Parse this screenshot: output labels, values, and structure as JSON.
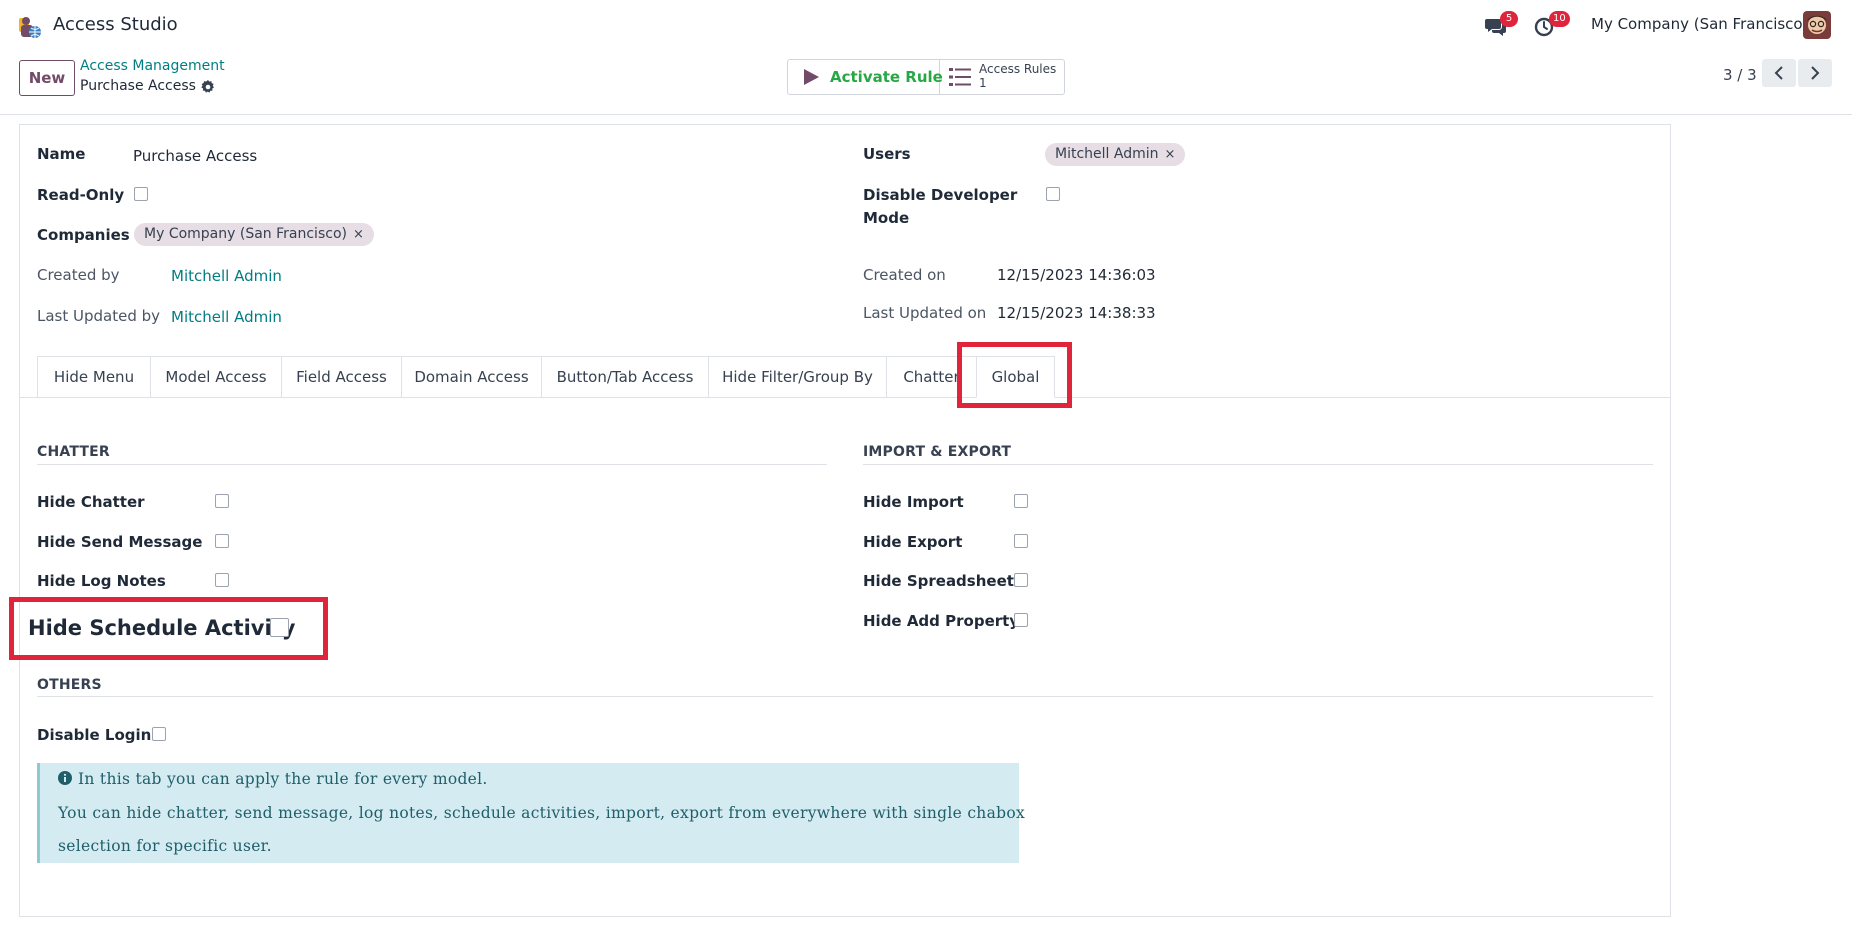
{
  "navbar": {
    "app_title": "Access Studio",
    "messages_badge": "5",
    "activities_badge": "10",
    "company": "My Company (San Francisco)"
  },
  "control_panel": {
    "new_label": "New",
    "breadcrumb_parent": "Access Management",
    "breadcrumb_current": "Purchase Access",
    "activate_label": "Activate Rule",
    "access_rules_label": "Access Rules",
    "access_rules_count": "1",
    "pager": "3 / 3"
  },
  "form": {
    "name_label": "Name",
    "name_value": "Purchase Access",
    "readonly_label": "Read-Only",
    "companies_label": "Companies",
    "companies_tag": "My Company (San Francisco)",
    "created_by_label": "Created by",
    "created_by_value": "Mitchell Admin",
    "last_updated_by_label": "Last Updated by",
    "last_updated_by_value": "Mitchell Admin",
    "users_label": "Users",
    "users_tag": "Mitchell Admin",
    "disable_dev_label_1": "Disable Developer",
    "disable_dev_label_2": "Mode",
    "created_on_label": "Created on",
    "created_on_value": "12/15/2023 14:36:03",
    "last_updated_on_label": "Last Updated on",
    "last_updated_on_value": "12/15/2023 14:38:33"
  },
  "tabs": [
    {
      "label": "Hide Menu"
    },
    {
      "label": "Model Access"
    },
    {
      "label": "Field Access"
    },
    {
      "label": "Domain Access"
    },
    {
      "label": "Button/Tab Access"
    },
    {
      "label": "Hide Filter/Group By"
    },
    {
      "label": "Chatter"
    },
    {
      "label": "Global"
    }
  ],
  "global_tab": {
    "chatter_title": "CHATTER",
    "hide_chatter": "Hide Chatter",
    "hide_send_message": "Hide Send Message",
    "hide_log_notes": "Hide Log Notes",
    "hide_schedule_activity": "Hide Schedule Activity",
    "import_export_title": "IMPORT & EXPORT",
    "hide_import": "Hide Import",
    "hide_export": "Hide Export",
    "hide_spreadsheet": "Hide Spreadsheet",
    "hide_add_property": "Hide Add Property",
    "others_title": "OTHERS",
    "disable_login": "Disable Login",
    "alert_line_1": "In this tab you can apply the rule for every model.",
    "alert_line_2": "You can hide chatter, send message, log notes, schedule activities, import, export from everywhere with single chabox",
    "alert_line_3": "selection for specific user."
  }
}
